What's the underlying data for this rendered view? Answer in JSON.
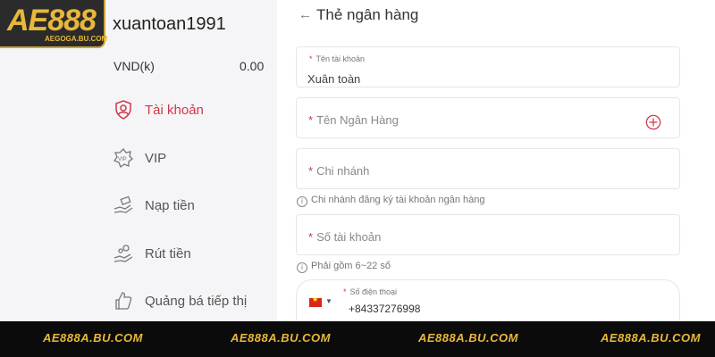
{
  "brand": {
    "logo_text": "AE888",
    "logo_sub": "AEGOGA.BU.COM"
  },
  "sidebar": {
    "username": "xuantoan1991",
    "balance_label": "VND(k)",
    "balance_value": "0.00",
    "items": [
      {
        "label": "Tài khoản",
        "icon": "user-shield-icon",
        "active": true
      },
      {
        "label": "VIP",
        "icon": "vip-badge-icon",
        "active": false
      },
      {
        "label": "Nạp tiền",
        "icon": "deposit-hand-icon",
        "active": false
      },
      {
        "label": "Rút tiền",
        "icon": "withdraw-hand-icon",
        "active": false
      },
      {
        "label": "Quảng bá tiếp thị",
        "icon": "thumbs-up-icon",
        "active": false
      }
    ]
  },
  "main": {
    "back_symbol": "←",
    "title": "Thẻ ngân hàng",
    "fields": {
      "account_name": {
        "label": "Tên tài khoản",
        "value": "Xuân toàn"
      },
      "bank_name": {
        "placeholder": "Tên Ngân Hàng"
      },
      "branch": {
        "placeholder": "Chi nhánh",
        "hint": "Chi nhánh đăng ký tài khoản ngân hàng"
      },
      "account_number": {
        "placeholder": "Số tài khoản",
        "hint": "Phải gồm 6~22 số"
      },
      "phone": {
        "label": "Số điện thoại",
        "value": "+84337276998",
        "country": "VN"
      }
    },
    "required_mark": "*"
  },
  "footer": {
    "watermarks": [
      "AE888A.BU.COM",
      "AE888A.BU.COM",
      "AE888A.BU.COM",
      "AE888A.BU.COM"
    ]
  },
  "colors": {
    "accent": "#d0364a",
    "gold": "#e8b83a",
    "sidebar_bg": "#f5f5f7",
    "footer_bg": "#0b0b0b"
  }
}
